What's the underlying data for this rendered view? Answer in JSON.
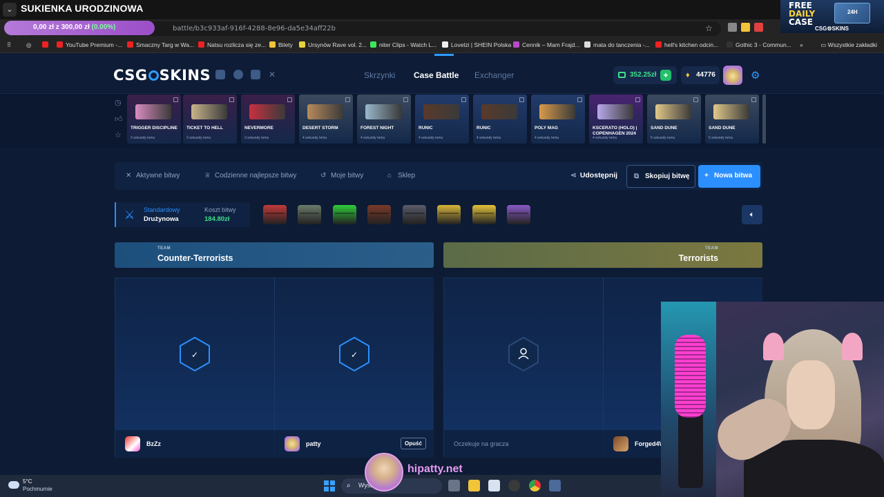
{
  "stream": {
    "title": "SUKIENKA URODZINOWA",
    "goal_text": "0,00 zł z 300,00 zł",
    "goal_pct": "(0.00%)",
    "watermark": "hipatty.net"
  },
  "browser": {
    "url": "battle/b3c933af-916f-4288-8e96-da5e34aff22b",
    "bookmarks": [
      "YouTube Premium -...",
      "Smaczny Targ w Wa...",
      "Natsu rozlicza się ze...",
      "Bilety",
      "Ursynów Rave vol. 2...",
      "niter Clips - Watch L...",
      "Lovelzi | SHEIN Polska",
      "Cennik – Mam Frajd...",
      "mata do tanczenia -...",
      "hell's kitchen odcin...",
      "Gothic 3 - Commun..."
    ],
    "all_bookmarks": "Wszystkie zakładki"
  },
  "ad": {
    "line1": "FREE",
    "line2": "DAILY",
    "line3": "CASE",
    "brand": "CSG⚙SKINS",
    "box_label": "24H"
  },
  "header": {
    "logo_left": "CSG",
    "logo_right": "SKINS",
    "nav": [
      "Skrzynki",
      "Case Battle",
      "Exchanger"
    ],
    "active_nav": "Case Battle",
    "balance": "352.25zł",
    "gems": "44776"
  },
  "drops": [
    {
      "name": "TRIGGER DISCIPLINE",
      "time": "3 sekundy temu",
      "bg": "#3a1f4a",
      "gun": "#d98cc0"
    },
    {
      "name": "TICKET TO HELL",
      "time": "3 sekundy temu",
      "bg": "#3a1f4a",
      "gun": "#c8b48a"
    },
    {
      "name": "NEVERMORE",
      "time": "3 sekundy temu",
      "bg": "#3a1f4a",
      "gun": "#c83040"
    },
    {
      "name": "DESERT STORM",
      "time": "4 sekundy temu",
      "bg": "#3c4a5e",
      "gun": "#b88a5a"
    },
    {
      "name": "FOREST NIGHT",
      "time": "4 sekundy temu",
      "bg": "#3c4a5e",
      "gun": "#9ab8cc"
    },
    {
      "name": "RUNIC",
      "time": "4 sekundy temu",
      "bg": "#233b6a",
      "gun": "#5a3a2a"
    },
    {
      "name": "RUNIC",
      "time": "4 sekundy temu",
      "bg": "#233b6a",
      "gun": "#5a3a2a"
    },
    {
      "name": "POLY MAG",
      "time": "4 sekundy temu",
      "bg": "#233b6a",
      "gun": "#d89a4a"
    },
    {
      "name": "KSCERATO (HOLO) | COPENHAGEN 2024",
      "time": "4 sekundy temu",
      "bg": "#4a2370",
      "gun": "#b8a8e8"
    },
    {
      "name": "SAND DUNE",
      "time": "5 sekundy temu",
      "bg": "#3c4a5e",
      "gun": "#e2c88a"
    },
    {
      "name": "SAND DUNE",
      "time": "5 sekundy temu",
      "bg": "#3c4a5e",
      "gun": "#e2c88a"
    }
  ],
  "toolbar": {
    "active": "Aktywne bitwy",
    "daily": "Codzienne najlepsze bitwy",
    "mine": "Moje bitwy",
    "shop": "Sklep",
    "share": "Udostępnij",
    "copy": "Skopiuj bitwę",
    "new": "Nowa bitwa"
  },
  "mode": {
    "type": "Standardowy",
    "team": "Drużynowa",
    "cost_label": "Koszt bitwy",
    "cost": "184.80zł"
  },
  "cases": [
    "#c23a3a",
    "#6b7a6a",
    "#2fcc3a",
    "#7a3a2a",
    "#5a5a6a",
    "#d8b63a",
    "#e2c23a",
    "#8a5ac8"
  ],
  "teams": {
    "ct_small": "TEAM",
    "ct_name": "Counter-Terrorists",
    "t_small": "TEAM",
    "t_name": "Terrorists"
  },
  "players": {
    "p1": "BzZz",
    "p2": "patty",
    "leave": "Opuść",
    "waiting": "Oczekuje na gracza",
    "p4": "Forged4W"
  },
  "taskbar": {
    "temp": "5°C",
    "weather": "Pochmurnie",
    "search": "Wysz"
  }
}
